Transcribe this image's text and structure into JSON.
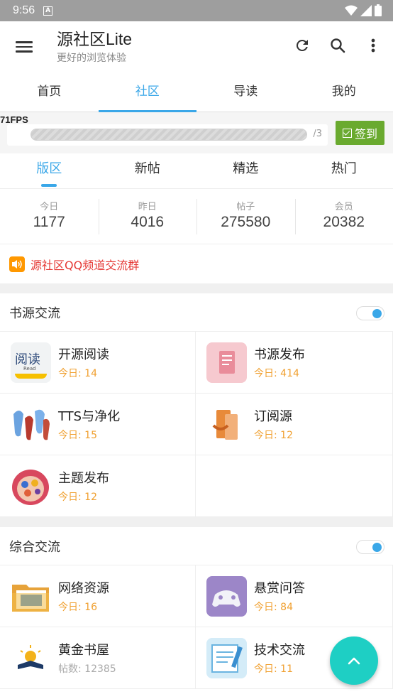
{
  "status_bar": {
    "time": "9:56",
    "notification": "A"
  },
  "app_bar": {
    "title": "源社区Lite",
    "subtitle": "更好的浏览体验"
  },
  "tabs": [
    {
      "label": "首页"
    },
    {
      "label": "社区"
    },
    {
      "label": "导读"
    },
    {
      "label": "我的"
    }
  ],
  "progress": {
    "fps": "71FPS",
    "count": "/3",
    "sign_label": "签到"
  },
  "subtabs": [
    {
      "label": "版区"
    },
    {
      "label": "新帖"
    },
    {
      "label": "精选"
    },
    {
      "label": "热门"
    }
  ],
  "stats": [
    {
      "label": "今日",
      "value": "1177"
    },
    {
      "label": "昨日",
      "value": "4016"
    },
    {
      "label": "帖子",
      "value": "275580"
    },
    {
      "label": "会员",
      "value": "20382"
    }
  ],
  "notice": {
    "text": "源社区QQ频道交流群"
  },
  "sections": [
    {
      "title": "书源交流",
      "items": [
        {
          "name": "开源阅读",
          "meta": "今日: 14"
        },
        {
          "name": "书源发布",
          "meta": "今日: 414"
        },
        {
          "name": "TTS与净化",
          "meta": "今日: 15"
        },
        {
          "name": "订阅源",
          "meta": "今日: 12"
        },
        {
          "name": "主题发布",
          "meta": "今日: 12"
        }
      ]
    },
    {
      "title": "综合交流",
      "items": [
        {
          "name": "网络资源",
          "meta": "今日: 16"
        },
        {
          "name": "悬赏问答",
          "meta": "今日: 84"
        },
        {
          "name": "黄金书屋",
          "meta": "帖数: 12385"
        },
        {
          "name": "技术交流",
          "meta": "今日: 11"
        }
      ]
    }
  ],
  "icons": {
    "logo_read_text": "阅读",
    "logo_read_sub": "Read"
  },
  "colors": {
    "accent": "#3aa7e8",
    "sign_green": "#6aaa2f",
    "fab": "#1ecfc4",
    "notice_red": "#e53935",
    "meta_orange": "#f0a030"
  }
}
